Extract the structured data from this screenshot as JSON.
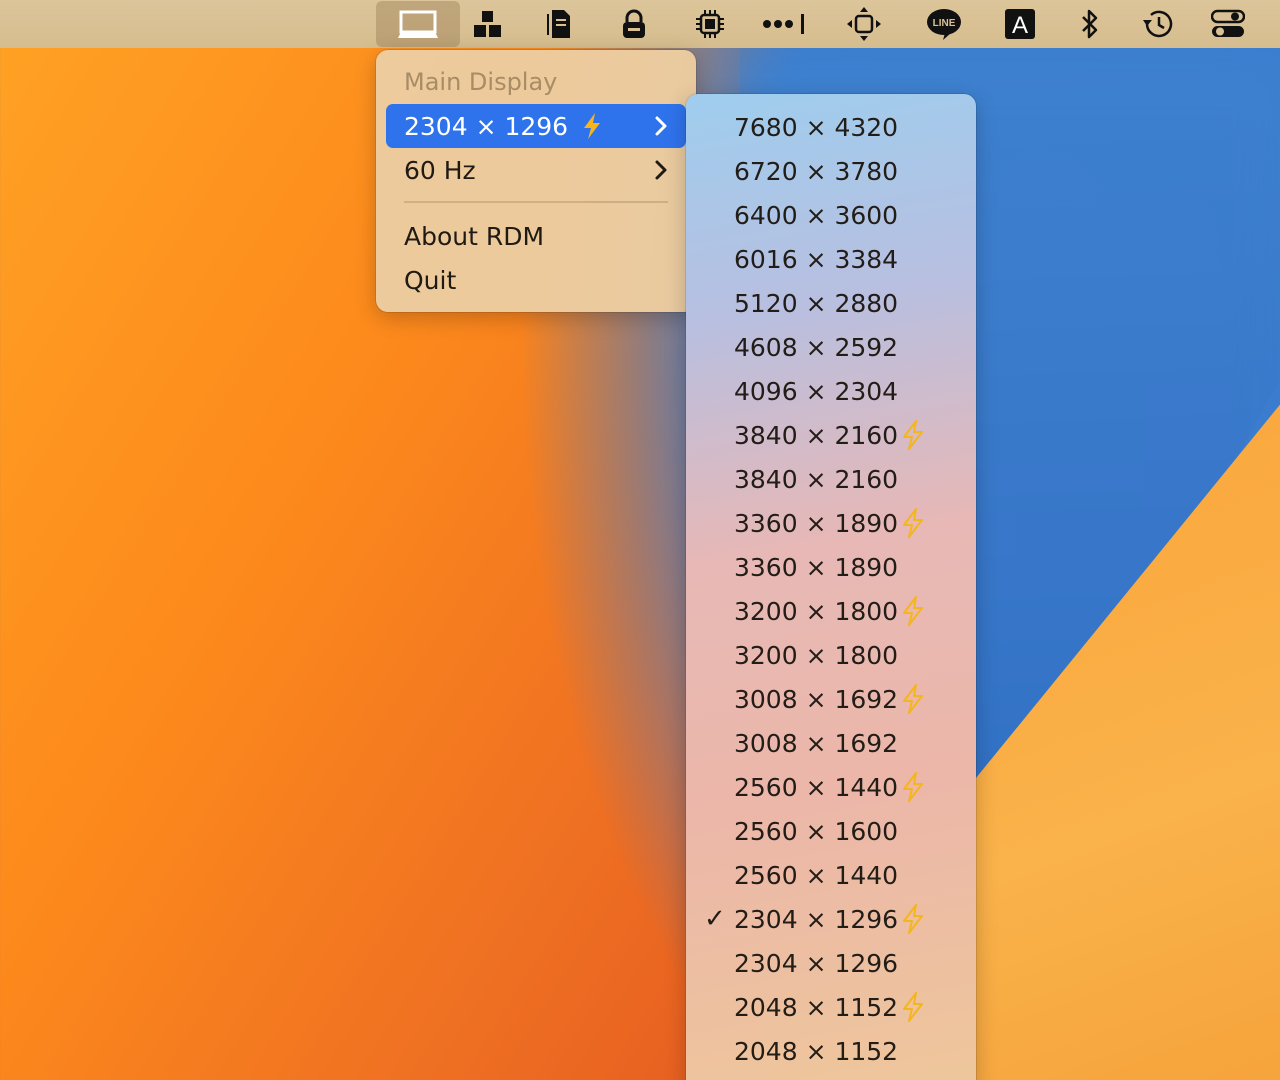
{
  "menubar": {
    "icons": [
      {
        "name": "display-icon",
        "active": true
      },
      {
        "name": "network-blocks-icon"
      },
      {
        "name": "clipboard-icon"
      },
      {
        "name": "lock-icon"
      },
      {
        "name": "cpu-icon"
      },
      {
        "name": "more-dots-icon"
      },
      {
        "name": "move-arrows-icon"
      },
      {
        "name": "line-app-icon",
        "text": "LINE"
      },
      {
        "name": "input-source-icon",
        "text": "A"
      },
      {
        "name": "bluetooth-icon"
      },
      {
        "name": "time-machine-icon"
      },
      {
        "name": "control-center-icon"
      }
    ]
  },
  "menu": {
    "header": "Main Display",
    "resolution_item": "2304 × 1296",
    "refresh_item": "60 Hz",
    "about_item": "About RDM",
    "quit_item": "Quit"
  },
  "submenu": {
    "items": [
      {
        "label": "7680 × 4320",
        "hidpi": false,
        "checked": false
      },
      {
        "label": "6720 × 3780",
        "hidpi": false,
        "checked": false
      },
      {
        "label": "6400 × 3600",
        "hidpi": false,
        "checked": false
      },
      {
        "label": "6016 × 3384",
        "hidpi": false,
        "checked": false
      },
      {
        "label": "5120 × 2880",
        "hidpi": false,
        "checked": false
      },
      {
        "label": "4608 × 2592",
        "hidpi": false,
        "checked": false
      },
      {
        "label": "4096 × 2304",
        "hidpi": false,
        "checked": false
      },
      {
        "label": "3840 × 2160",
        "hidpi": true,
        "checked": false
      },
      {
        "label": "3840 × 2160",
        "hidpi": false,
        "checked": false
      },
      {
        "label": "3360 × 1890",
        "hidpi": true,
        "checked": false
      },
      {
        "label": "3360 × 1890",
        "hidpi": false,
        "checked": false
      },
      {
        "label": "3200 × 1800",
        "hidpi": true,
        "checked": false
      },
      {
        "label": "3200 × 1800",
        "hidpi": false,
        "checked": false
      },
      {
        "label": "3008 × 1692",
        "hidpi": true,
        "checked": false
      },
      {
        "label": "3008 × 1692",
        "hidpi": false,
        "checked": false
      },
      {
        "label": "2560 × 1440",
        "hidpi": true,
        "checked": false
      },
      {
        "label": "2560 × 1600",
        "hidpi": false,
        "checked": false
      },
      {
        "label": "2560 × 1440",
        "hidpi": false,
        "checked": false
      },
      {
        "label": "2304 × 1296",
        "hidpi": true,
        "checked": true
      },
      {
        "label": "2304 × 1296",
        "hidpi": false,
        "checked": false
      },
      {
        "label": "2048 × 1152",
        "hidpi": true,
        "checked": false
      },
      {
        "label": "2048 × 1152",
        "hidpi": false,
        "checked": false
      }
    ]
  },
  "colors": {
    "selection": "#2f73ec",
    "bolt": "#f5b51c"
  }
}
